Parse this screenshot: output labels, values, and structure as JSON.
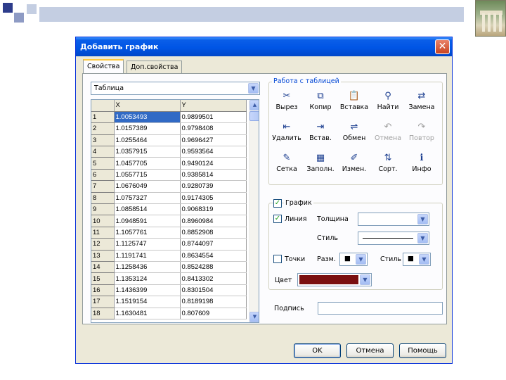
{
  "dialog": {
    "title": "Добавить график",
    "close_glyph": "✕"
  },
  "tabs": [
    {
      "label": "Свойства",
      "active": true
    },
    {
      "label": "Доп.свойства",
      "active": false
    }
  ],
  "source_combo": {
    "value": "Таблица"
  },
  "table": {
    "headers": [
      "",
      "X",
      "Y"
    ],
    "rows": [
      [
        "1",
        "1.0053493",
        "0.9899501"
      ],
      [
        "2",
        "1.0157389",
        "0.9798408"
      ],
      [
        "3",
        "1.0255464",
        "0.9696427"
      ],
      [
        "4",
        "1.0357915",
        "0.9593564"
      ],
      [
        "5",
        "1.0457705",
        "0.9490124"
      ],
      [
        "6",
        "1.0557715",
        "0.9385814"
      ],
      [
        "7",
        "1.0676049",
        "0.9280739"
      ],
      [
        "8",
        "1.0757327",
        "0.9174305"
      ],
      [
        "9",
        "1.0858514",
        "0.9068319"
      ],
      [
        "10",
        "1.0948591",
        "0.8960984"
      ],
      [
        "11",
        "1.1057761",
        "0.8852908"
      ],
      [
        "12",
        "1.1125747",
        "0.8744097"
      ],
      [
        "13",
        "1.1191741",
        "0.8634554"
      ],
      [
        "14",
        "1.1258436",
        "0.8524288"
      ],
      [
        "15",
        "1.1353124",
        "0.8413302"
      ],
      [
        "16",
        "1.1436399",
        "0.8301504"
      ],
      [
        "17",
        "1.1519154",
        "0.8189198"
      ],
      [
        "18",
        "1.1630481",
        "0.807609"
      ]
    ],
    "selected_cell": "1.0053493"
  },
  "table_tools": {
    "group_label": "Работа с таблицей",
    "buttons": [
      {
        "label": "Вырез",
        "icon": "scissors-icon",
        "glyph": "✂",
        "enabled": true
      },
      {
        "label": "Копир",
        "icon": "copy-icon",
        "glyph": "⧉",
        "enabled": true
      },
      {
        "label": "Вставка",
        "icon": "paste-icon",
        "glyph": "📋",
        "enabled": true
      },
      {
        "label": "Найти",
        "icon": "binoculars-icon",
        "glyph": "⚲",
        "enabled": true
      },
      {
        "label": "Замена",
        "icon": "replace-icon",
        "glyph": "⇄",
        "enabled": true
      },
      {
        "label": "Удалить",
        "icon": "delete-rows-icon",
        "glyph": "⇤",
        "enabled": true
      },
      {
        "label": "Встав.",
        "icon": "insert-rows-icon",
        "glyph": "⇥",
        "enabled": true
      },
      {
        "label": "Обмен",
        "icon": "swap-icon",
        "glyph": "⇌",
        "enabled": true
      },
      {
        "label": "Отмена",
        "icon": "undo-icon",
        "glyph": "↶",
        "enabled": false
      },
      {
        "label": "Повтор",
        "icon": "redo-icon",
        "glyph": "↷",
        "enabled": false
      },
      {
        "label": "Сетка",
        "icon": "grid-brush-icon",
        "glyph": "✎",
        "enabled": true
      },
      {
        "label": "Заполн.",
        "icon": "fill-icon",
        "glyph": "▦",
        "enabled": true
      },
      {
        "label": "Измен.",
        "icon": "edit-icon",
        "glyph": "✐",
        "enabled": true
      },
      {
        "label": "Сорт.",
        "icon": "sort-icon",
        "glyph": "⇅",
        "enabled": true
      },
      {
        "label": "Инфо",
        "icon": "info-icon",
        "glyph": "ℹ",
        "enabled": true
      }
    ]
  },
  "graph": {
    "label": "График",
    "checked": true,
    "line": {
      "label": "Линия",
      "checked": true,
      "thickness_label": "Толщина",
      "thickness_value": "",
      "style_label": "Стиль"
    },
    "points": {
      "label": "Точки",
      "checked": false,
      "size_label": "Разм.",
      "style_label": "Стиль",
      "size_glyph": "■",
      "style_glyph": "■"
    },
    "color_label": "Цвет",
    "color_value": "#7a0f0f"
  },
  "caption": {
    "label": "Подпись",
    "value": ""
  },
  "buttons": {
    "ok": "OK",
    "cancel": "Отмена",
    "help": "Помощь"
  },
  "colors": {
    "title_bar": "#0055e5",
    "selection": "#316ac5",
    "group_label": "#0046d5",
    "graph_color": "#7a0f0f",
    "check": "#21a121"
  }
}
